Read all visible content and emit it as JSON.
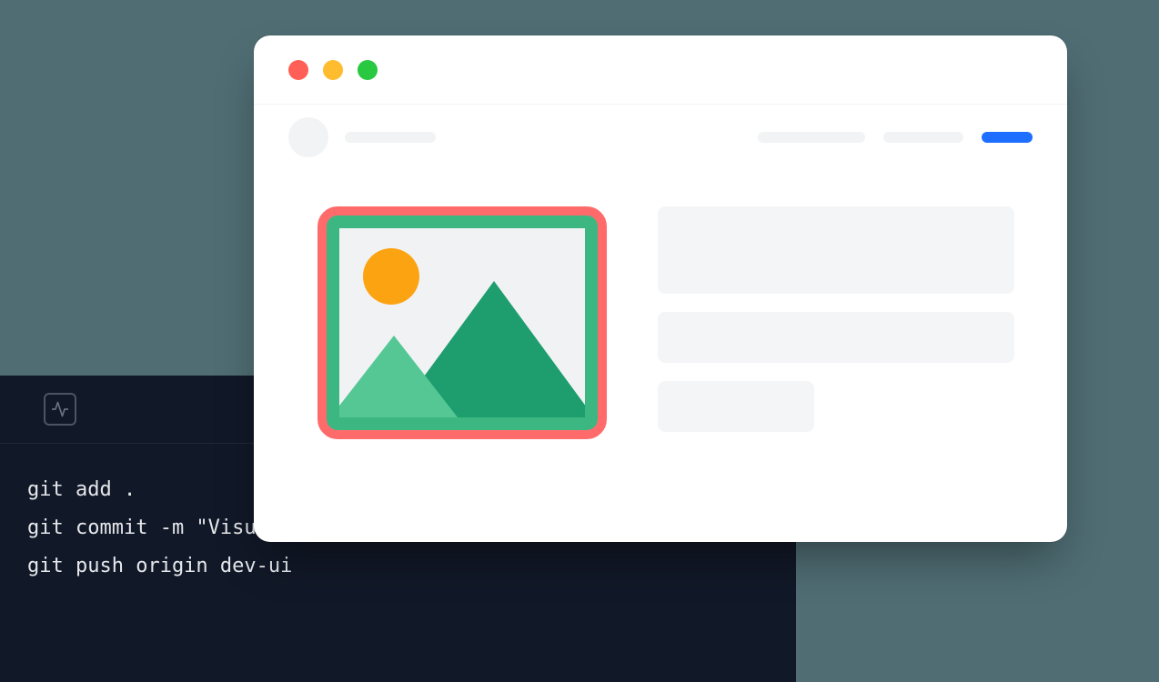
{
  "terminal": {
    "icon": "activity-icon",
    "lines": [
      "git add .",
      "git commit -m \"Visual changes\"",
      "git push origin dev-ui"
    ]
  },
  "browser": {
    "traffic_lights": {
      "close_color": "#ff5f57",
      "minimize_color": "#febc2e",
      "zoom_color": "#28c840"
    },
    "highlight_color": "#ff6b6b",
    "image_placeholder": {
      "icon": "image-icon"
    }
  }
}
